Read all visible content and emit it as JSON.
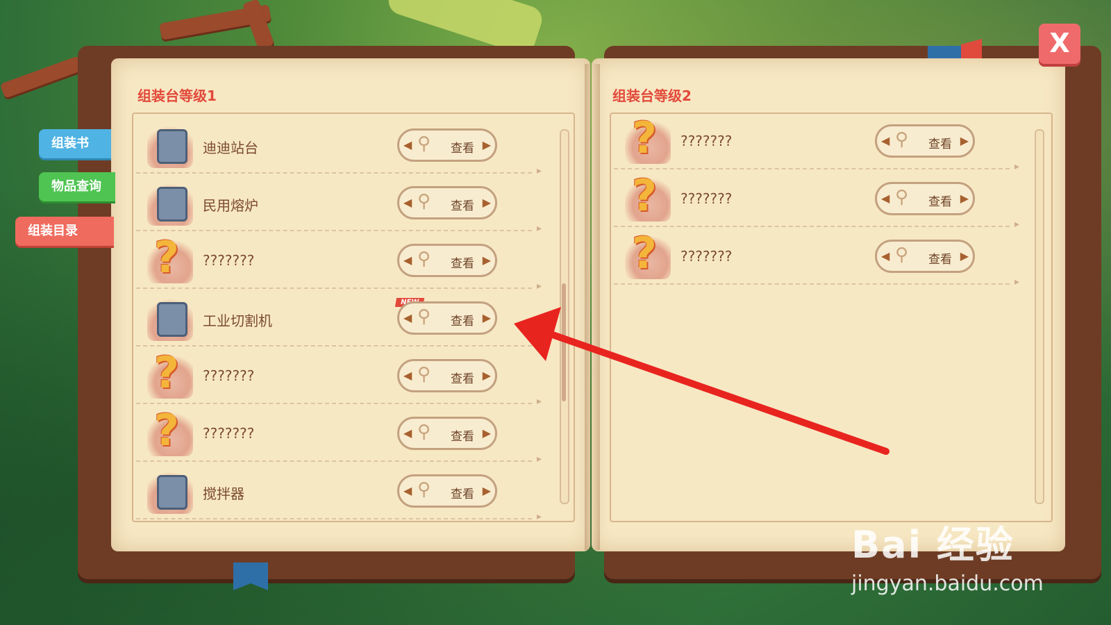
{
  "tabs": [
    {
      "label": "组装书"
    },
    {
      "label": "物品查询"
    },
    {
      "label": "组装目录"
    }
  ],
  "close_label": "X",
  "left_page": {
    "title": "组装台等级1",
    "items": [
      {
        "name": "迪迪站台",
        "icon": "workbench-icon",
        "button": "查看",
        "is_new": false
      },
      {
        "name": "民用熔炉",
        "icon": "furnace-icon",
        "button": "查看",
        "is_new": false
      },
      {
        "name": "???????",
        "icon": "question-mark-icon",
        "button": "查看",
        "is_new": false
      },
      {
        "name": "工业切割机",
        "icon": "cutting-machine-icon",
        "button": "查看",
        "is_new": true,
        "badge": "NEW"
      },
      {
        "name": "???????",
        "icon": "question-mark-icon",
        "button": "查看",
        "is_new": false
      },
      {
        "name": "???????",
        "icon": "question-mark-icon",
        "button": "查看",
        "is_new": false
      },
      {
        "name": "搅拌器",
        "icon": "mixer-icon",
        "button": "查看",
        "is_new": false
      }
    ]
  },
  "right_page": {
    "title": "组装台等级2",
    "items": [
      {
        "name": "???????",
        "icon": "question-mark-icon",
        "button": "查看"
      },
      {
        "name": "???????",
        "icon": "question-mark-icon",
        "button": "查看"
      },
      {
        "name": "???????",
        "icon": "question-mark-icon",
        "button": "查看"
      }
    ]
  },
  "watermark": {
    "brand": "Bai 经验",
    "url": "jingyan.baidu.com"
  },
  "colors": {
    "title_red": "#e2493a",
    "tab_blue": "#4fb3e3",
    "tab_green": "#4fc452",
    "tab_red": "#ef6b5e",
    "page_bg": "#f7e8c4"
  }
}
